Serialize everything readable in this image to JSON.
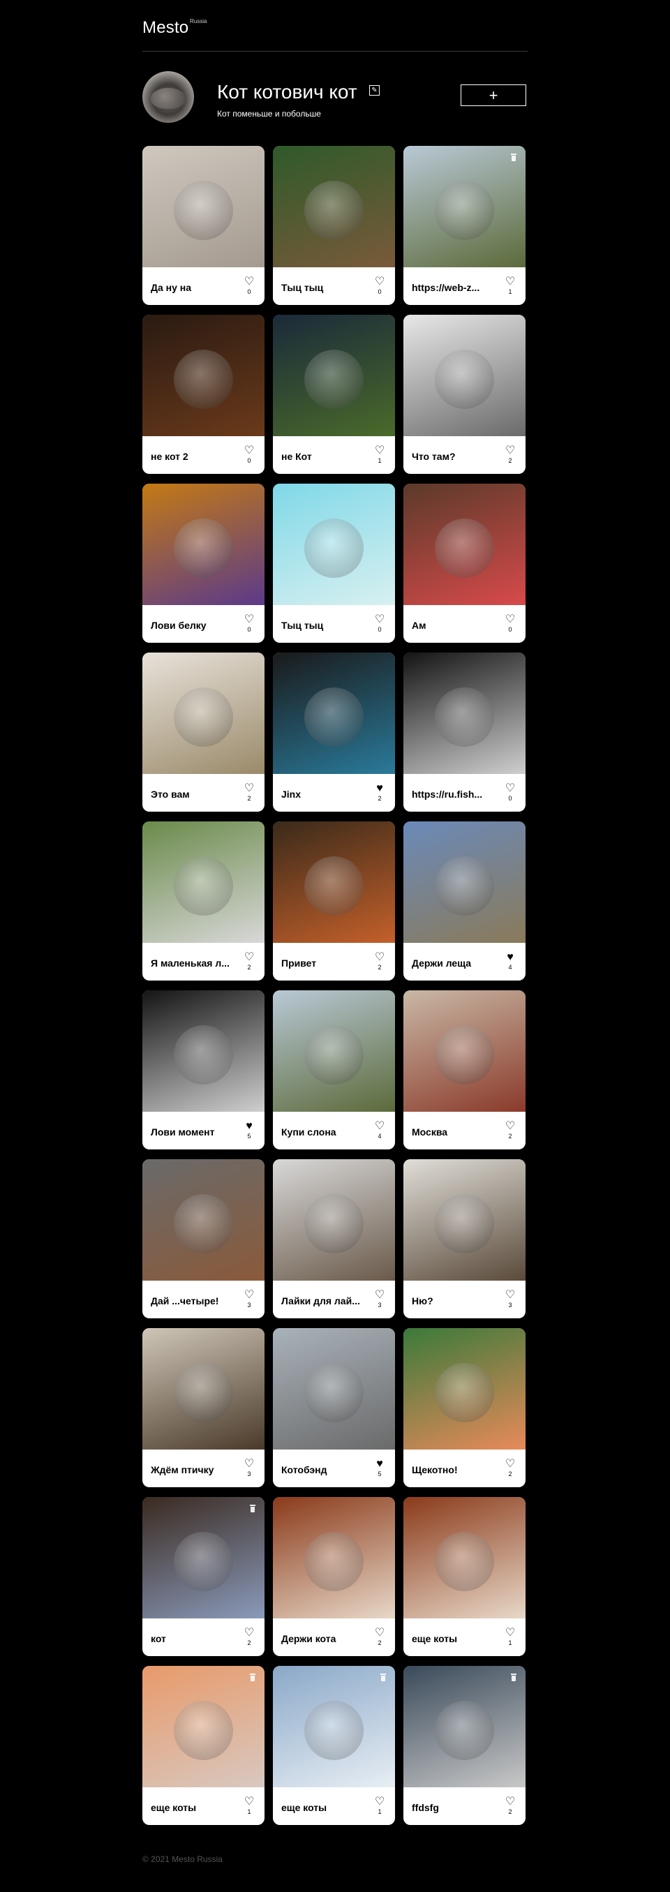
{
  "header": {
    "logo": "Mesto",
    "logo_sup": "Russia"
  },
  "profile": {
    "name": "Кот котович кот",
    "about": "Кот поменьше и побольше",
    "add_label": "+"
  },
  "cards": [
    {
      "title": "Да ну на",
      "likes": "0",
      "liked": false,
      "trash": false,
      "bg": [
        "#cfc8bf",
        "#a49a8f"
      ]
    },
    {
      "title": "Тыц тыц",
      "likes": "0",
      "liked": false,
      "trash": false,
      "bg": [
        "#2e5a2a",
        "#7a5a3a"
      ]
    },
    {
      "title": "https://web-z...",
      "likes": "1",
      "liked": false,
      "trash": true,
      "bg": [
        "#b9c9d6",
        "#5c6a3a"
      ]
    },
    {
      "title": "не кот 2",
      "likes": "0",
      "liked": false,
      "trash": false,
      "bg": [
        "#2a1a12",
        "#6a3a1a"
      ]
    },
    {
      "title": "не Кот",
      "likes": "1",
      "liked": false,
      "trash": false,
      "bg": [
        "#1a2a3a",
        "#4a6a2a"
      ]
    },
    {
      "title": "Что там?",
      "likes": "2",
      "liked": false,
      "trash": false,
      "bg": [
        "#e8e8e8",
        "#6a6a6a"
      ]
    },
    {
      "title": "Лови белку",
      "likes": "0",
      "liked": false,
      "trash": false,
      "bg": [
        "#c47a14",
        "#5b3a8a"
      ]
    },
    {
      "title": "Тыц тыц",
      "likes": "0",
      "liked": false,
      "trash": false,
      "bg": [
        "#7fd8e8",
        "#d8f0f0"
      ]
    },
    {
      "title": "Ам",
      "likes": "0",
      "liked": false,
      "trash": false,
      "bg": [
        "#5a3a2a",
        "#d84a4a"
      ]
    },
    {
      "title": "Это вам",
      "likes": "2",
      "liked": false,
      "trash": false,
      "bg": [
        "#e8e2da",
        "#9a8a6a"
      ]
    },
    {
      "title": "Jinx",
      "likes": "2",
      "liked": true,
      "trash": false,
      "bg": [
        "#1a1a1a",
        "#2a7a9a"
      ]
    },
    {
      "title": "https://ru.fish...",
      "likes": "0",
      "liked": false,
      "trash": false,
      "bg": [
        "#141414",
        "#cfcfcf"
      ]
    },
    {
      "title": "Я маленькая л...",
      "likes": "2",
      "liked": false,
      "trash": false,
      "bg": [
        "#6a8a4a",
        "#d8d8d8"
      ]
    },
    {
      "title": "Привет",
      "likes": "2",
      "liked": false,
      "trash": false,
      "bg": [
        "#3a2a1a",
        "#c4602a"
      ]
    },
    {
      "title": "Держи леща",
      "likes": "4",
      "liked": true,
      "trash": false,
      "bg": [
        "#6a8aba",
        "#8a7a5a"
      ]
    },
    {
      "title": "Лови момент",
      "likes": "5",
      "liked": true,
      "trash": false,
      "bg": [
        "#141414",
        "#cfcfcf"
      ]
    },
    {
      "title": "Купи слона",
      "likes": "4",
      "liked": false,
      "trash": false,
      "bg": [
        "#b9c9d6",
        "#5c6a3a"
      ]
    },
    {
      "title": "Москва",
      "likes": "2",
      "liked": false,
      "trash": false,
      "bg": [
        "#c9b8a6",
        "#8a3a2a"
      ]
    },
    {
      "title": "Дай ...четыре!",
      "likes": "3",
      "liked": false,
      "trash": false,
      "bg": [
        "#6a6a6a",
        "#8a5a3a"
      ]
    },
    {
      "title": "Лайки для лай...",
      "likes": "3",
      "liked": false,
      "trash": false,
      "bg": [
        "#d8d8d8",
        "#6a5a4a"
      ]
    },
    {
      "title": "Ню?",
      "likes": "3",
      "liked": false,
      "trash": false,
      "bg": [
        "#e0ded8",
        "#5a4a3a"
      ]
    },
    {
      "title": "Ждём птичку",
      "likes": "3",
      "liked": false,
      "trash": false,
      "bg": [
        "#cfc6b8",
        "#4a3a2a"
      ]
    },
    {
      "title": "Котобэнд",
      "likes": "5",
      "liked": true,
      "trash": false,
      "bg": [
        "#a9b2ba",
        "#6a6a6a"
      ]
    },
    {
      "title": "Щекотно!",
      "likes": "2",
      "liked": false,
      "trash": false,
      "bg": [
        "#3a7a3a",
        "#e88a5a"
      ]
    },
    {
      "title": "кот",
      "likes": "2",
      "liked": false,
      "trash": true,
      "bg": [
        "#3a2a20",
        "#8a9aba"
      ]
    },
    {
      "title": "Держи кота",
      "likes": "2",
      "liked": false,
      "trash": false,
      "bg": [
        "#8a3a1a",
        "#e8d8c8"
      ]
    },
    {
      "title": "еще коты",
      "likes": "1",
      "liked": false,
      "trash": false,
      "bg": [
        "#8a3a1a",
        "#e8d8c8"
      ]
    },
    {
      "title": "еще коты",
      "likes": "1",
      "liked": false,
      "trash": true,
      "bg": [
        "#e89a6a",
        "#d8c8c0"
      ]
    },
    {
      "title": "еще коты",
      "likes": "1",
      "liked": false,
      "trash": true,
      "bg": [
        "#8aa8c8",
        "#e8eef4"
      ]
    },
    {
      "title": "ffdsfg",
      "likes": "2",
      "liked": false,
      "trash": true,
      "bg": [
        "#3a4a5a",
        "#c8c8c8"
      ]
    }
  ],
  "footer": {
    "text": "© 2021 Mesto Russia"
  },
  "icons": {
    "heart": "heart-icon",
    "heart_filled": "heart-filled-icon",
    "trash": "trash-icon",
    "edit": "edit-icon",
    "plus": "plus-icon"
  }
}
